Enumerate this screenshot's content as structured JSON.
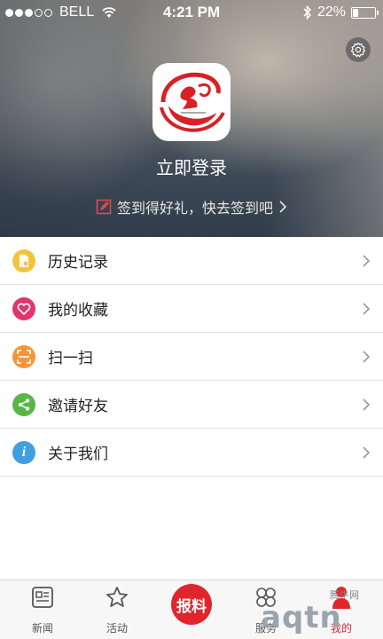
{
  "status_bar": {
    "carrier": "BELL",
    "time": "4:21 PM",
    "battery": "22%",
    "battery_level": 0.22,
    "signal_bars_filled": 3
  },
  "header": {
    "settings_icon": "gear-icon",
    "login_title": "立即登录",
    "signin_text": "签到得好礼，快去签到吧",
    "signin_icon": "edit-icon"
  },
  "menu": [
    {
      "label": "历史记录",
      "icon": "history-icon",
      "color": "#f2c43d"
    },
    {
      "label": "我的收藏",
      "icon": "heart-icon",
      "color": "#e0356d"
    },
    {
      "label": "扫一扫",
      "icon": "scan-icon",
      "color": "#f4953b"
    },
    {
      "label": "邀请好友",
      "icon": "share-icon",
      "color": "#57b745"
    },
    {
      "label": "关于我们",
      "icon": "info-icon",
      "color": "#3f9fe0"
    }
  ],
  "tabbar": {
    "news": "新闻",
    "activity": "活动",
    "report": "报料",
    "services": "服务",
    "mine": "我的"
  },
  "watermark": {
    "text": "aqtn",
    "small": "腾牛网"
  },
  "colors": {
    "accent": "#e0262c",
    "divider": "#e3e3e3"
  }
}
